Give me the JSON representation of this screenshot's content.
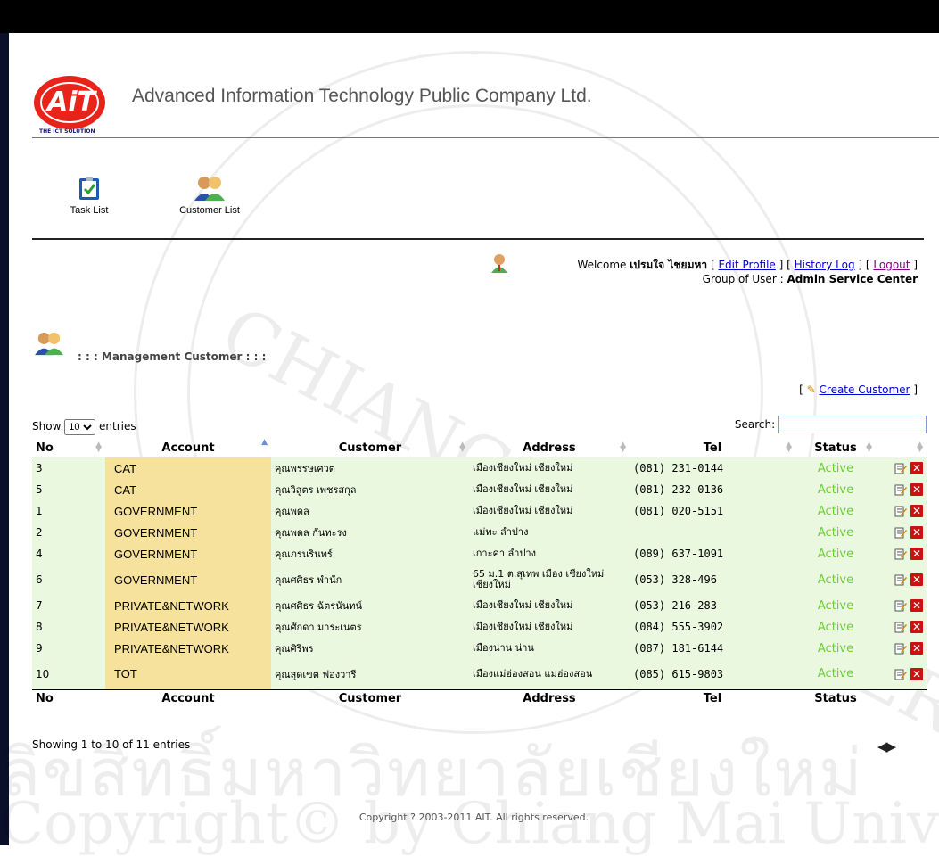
{
  "header": {
    "company_name": "Advanced Information Technology Public Company Ltd.",
    "logo_text": "AiT",
    "logo_tagline": "THE ICT SOLUTION"
  },
  "nav": [
    {
      "label": "Task List",
      "icon": "task-list-icon"
    },
    {
      "label": "Customer List",
      "icon": "customer-list-icon"
    }
  ],
  "user": {
    "welcome_prefix": "Welcome",
    "name": "เปรมใจ ไชยมหา",
    "links": [
      "Edit Profile",
      "History Log",
      "Logout"
    ],
    "group_label": "Group of User :",
    "group_value": "Admin Service Center"
  },
  "page_title": ": : : Management Customer : : :",
  "create_button": "Create Customer",
  "table": {
    "show_label": "Show",
    "entries_label": "entries",
    "page_size": "10",
    "search_label": "Search:",
    "search_value": "",
    "columns": [
      "No",
      "Account",
      "Customer",
      "Address",
      "Tel",
      "Status"
    ],
    "rows": [
      {
        "no": "3",
        "account": "CAT",
        "customer": "คุณพรรษเศวต",
        "address": "เมืองเชียงใหม่    เชียงใหม่",
        "tel": "(081) 231-0144",
        "status": "Active"
      },
      {
        "no": "5",
        "account": "CAT",
        "customer": "คุณวิสูตร เพชรสกุล",
        "address": "เมืองเชียงใหม่    เชียงใหม่",
        "tel": "(081) 232-0136",
        "status": "Active"
      },
      {
        "no": "1",
        "account": "GOVERNMENT",
        "customer": "คุณพดล",
        "address": "เมืองเชียงใหม่    เชียงใหม่",
        "tel": "(081) 020-5151",
        "status": "Active"
      },
      {
        "no": "2",
        "account": "GOVERNMENT",
        "customer": "คุณพดล กันทะรง",
        "address": "แม่ทะ    ลำปาง",
        "tel": "",
        "status": "Active"
      },
      {
        "no": "4",
        "account": "GOVERNMENT",
        "customer": "คุณภรนรินทร์",
        "address": "เกาะคา    ลำปาง",
        "tel": "(089) 637-1091",
        "status": "Active"
      },
      {
        "no": "6",
        "account": "GOVERNMENT",
        "customer": "คุณศศิธร พำนัก",
        "address": "65 ม.1 ต.สุเทพ    เมือง เชียงใหม่    เชียงใหม่",
        "tel": "(053) 328-496",
        "status": "Active"
      },
      {
        "no": "7",
        "account": "PRIVATE&NETWORK",
        "customer": "คุณศศิธร ฉัตรนันทน์",
        "address": "เมืองเชียงใหม่    เชียงใหม่",
        "tel": "(053) 216-283",
        "status": "Active"
      },
      {
        "no": "8",
        "account": "PRIVATE&NETWORK",
        "customer": "คุณศักดา มาระเนตร",
        "address": "เมืองเชียงใหม่    เชียงใหม่",
        "tel": "(084) 555-3902",
        "status": "Active"
      },
      {
        "no": "9",
        "account": "PRIVATE&NETWORK",
        "customer": "คุณศิริพร",
        "address": "เมืองน่าน    น่าน",
        "tel": "(087) 181-6144",
        "status": "Active"
      },
      {
        "no": "10",
        "account": "TOT",
        "customer": "คุณสุดเขต ฟองวารี",
        "address": "เมืองแม่ฮ่องสอน    แม่ฮ่องสอน",
        "tel": "(085) 615-9803",
        "status": "Active"
      }
    ],
    "info": "Showing 1 to 10 of 11 entries"
  },
  "footer": {
    "copyright": "Copyright ? 2003-2011 AIT. All rights reserved."
  },
  "watermark": {
    "line1": "ลิขสิทธิ์มหาวิทยาลัยเชียงใหม่",
    "line2": "Copyright© by Chiang Mai University",
    "seal_text": "CHIANG MAI UNIVERSITY"
  },
  "colors": {
    "status_active": "#6ecc3a",
    "account_col": "#f6e29c",
    "row_bg": "#eaf8e0",
    "link": "#0000cc",
    "delete": "#cc1111"
  }
}
